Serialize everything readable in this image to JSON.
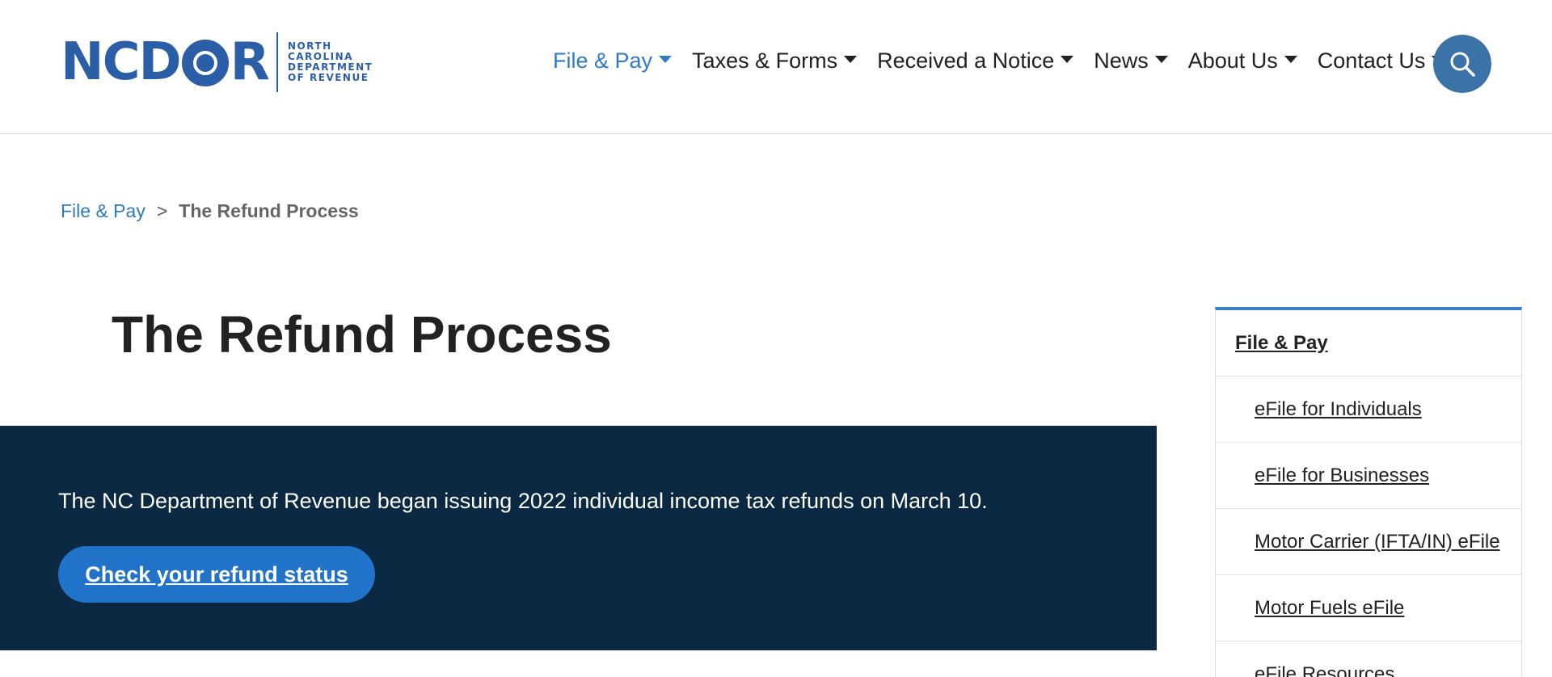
{
  "logo": {
    "word_left": "NC",
    "word_right": "R",
    "sub_lines": [
      "NORTH",
      "CAROLINA",
      "DEPARTMENT",
      "OF REVENUE"
    ],
    "brand_color": "#2a5fa8"
  },
  "nav": {
    "items": [
      {
        "label": "File & Pay",
        "active": true
      },
      {
        "label": "Taxes & Forms"
      },
      {
        "label": "Received a Notice"
      },
      {
        "label": "News"
      },
      {
        "label": "About Us"
      },
      {
        "label": "Contact Us"
      }
    ],
    "active_color": "#2e7ac6",
    "search_icon": "search-icon"
  },
  "breadcrumb": {
    "parent": "File & Pay",
    "separator": ">",
    "current": "The Refund Process"
  },
  "page": {
    "title": "The Refund Process"
  },
  "banner": {
    "text": "The NC Department of Revenue began issuing 2022 individual income tax refunds on March 10.",
    "button_label": "Check your refund status",
    "background": "#0b2942",
    "button_color": "#2173c9"
  },
  "sidenav": {
    "heading": "File & Pay",
    "items": [
      "eFile for Individuals",
      "eFile for Businesses",
      "Motor Carrier (IFTA/IN) eFile",
      "Motor Fuels eFile",
      "eFile Resources"
    ],
    "accent": "#3781c4"
  }
}
